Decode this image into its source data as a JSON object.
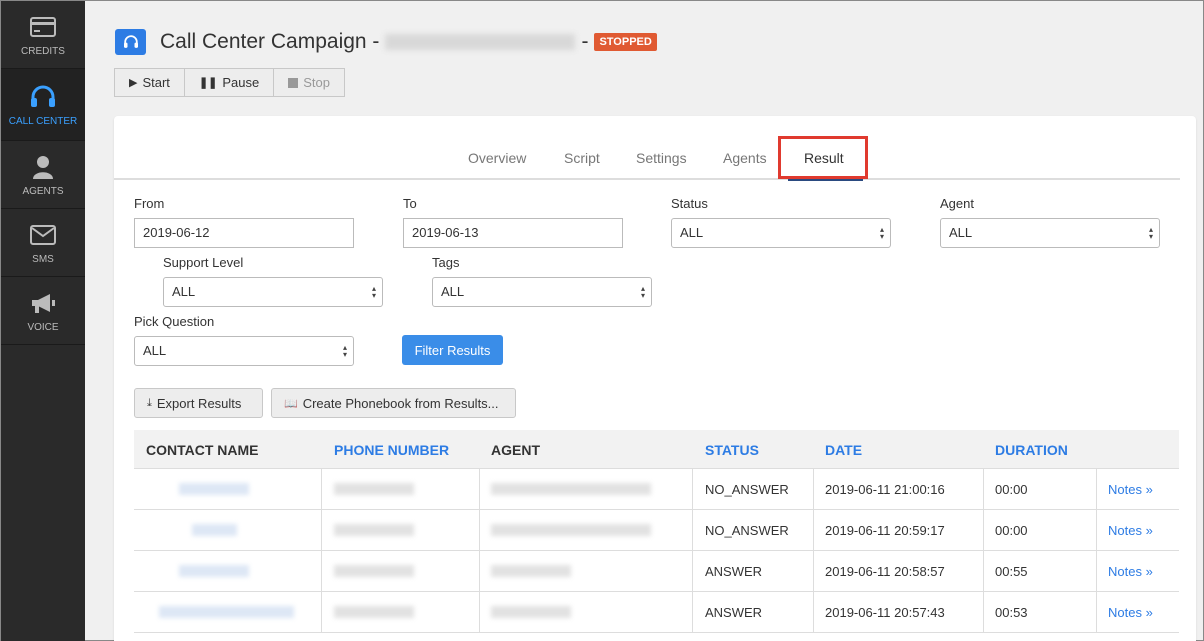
{
  "sidebar": {
    "items": [
      {
        "label": "CREDITS",
        "icon": "credit-card-icon"
      },
      {
        "label": "CALL CENTER",
        "icon": "headset-icon"
      },
      {
        "label": "AGENTS",
        "icon": "person-icon"
      },
      {
        "label": "SMS",
        "icon": "envelope-icon"
      },
      {
        "label": "VOICE",
        "icon": "megaphone-icon"
      }
    ]
  },
  "header": {
    "title": "Call Center Campaign -",
    "title_suffix": "-",
    "status_badge": "STOPPED",
    "controls": {
      "start": "Start",
      "pause": "Pause",
      "stop": "Stop"
    }
  },
  "tabs": [
    "Overview",
    "Script",
    "Settings",
    "Agents",
    "Result"
  ],
  "active_tab": "Result",
  "filters": {
    "from_label": "From",
    "from_value": "2019-06-12",
    "to_label": "To",
    "to_value": "2019-06-13",
    "status_label": "Status",
    "status_value": "ALL",
    "agent_label": "Agent",
    "agent_value": "ALL",
    "support_label": "Support Level",
    "support_value": "ALL",
    "tags_label": "Tags",
    "tags_value": "ALL",
    "question_label": "Pick Question",
    "question_value": "ALL",
    "filter_button": "Filter Results"
  },
  "actions": {
    "export": "Export Results",
    "phonebook": "Create Phonebook from Results..."
  },
  "table": {
    "headers": [
      "CONTACT NAME",
      "PHONE NUMBER",
      "AGENT",
      "STATUS",
      "DATE",
      "DURATION"
    ],
    "rows": [
      {
        "status": "NO_ANSWER",
        "date": "2019-06-11 21:00:16",
        "duration": "00:00",
        "notes": "Notes »"
      },
      {
        "status": "NO_ANSWER",
        "date": "2019-06-11 20:59:17",
        "duration": "00:00",
        "notes": "Notes »"
      },
      {
        "status": "ANSWER",
        "date": "2019-06-11 20:58:57",
        "duration": "00:55",
        "notes": "Notes »"
      },
      {
        "status": "ANSWER",
        "date": "2019-06-11 20:57:43",
        "duration": "00:53",
        "notes": "Notes »"
      }
    ]
  }
}
